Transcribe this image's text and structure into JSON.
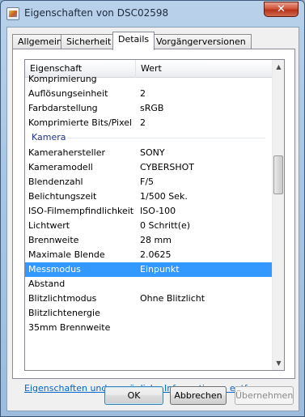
{
  "window": {
    "title": "Eigenschaften von DSC02598",
    "close_glyph": "✕"
  },
  "tabs": [
    {
      "label": "Allgemein",
      "active": false
    },
    {
      "label": "Sicherheit",
      "active": false
    },
    {
      "label": "Details",
      "active": true
    },
    {
      "label": "Vorgängerversionen",
      "active": false
    }
  ],
  "list": {
    "columns": {
      "property": "Eigenschaft",
      "value": "Wert"
    },
    "rows": [
      {
        "k": "Komprimierung",
        "v": ""
      },
      {
        "k": "Auflösungseinheit",
        "v": "2"
      },
      {
        "k": "Farbdarstellung",
        "v": "sRGB"
      },
      {
        "k": "Komprimierte Bits/Pixel",
        "v": "2"
      },
      {
        "k": "Kamera",
        "v": ""
      },
      {
        "k": "Kamerahersteller",
        "v": "SONY"
      },
      {
        "k": "Kameramodell",
        "v": "CYBERSHOT"
      },
      {
        "k": "Blendenzahl",
        "v": "F/5"
      },
      {
        "k": "Belichtungszeit",
        "v": "1/500 Sek."
      },
      {
        "k": "ISO-Filmempfindlichkeit",
        "v": "ISO-100"
      },
      {
        "k": "Lichtwert",
        "v": "0 Schritt(e)"
      },
      {
        "k": "Brennweite",
        "v": "28 mm"
      },
      {
        "k": "Maximale Blende",
        "v": "2.0625"
      },
      {
        "k": "Messmodus",
        "v": "Einpunkt"
      },
      {
        "k": "Abstand",
        "v": ""
      },
      {
        "k": "Blitzlichtmodus",
        "v": "Ohne Blitzlicht"
      },
      {
        "k": "Blitzlichtenergie",
        "v": ""
      },
      {
        "k": "35mm Brennweite",
        "v": ""
      }
    ],
    "scroll_up_glyph": "▲",
    "scroll_down_glyph": "▼"
  },
  "link_text": "Eigenschaften und persönliche Informationen entfernen",
  "buttons": {
    "ok": "OK",
    "cancel": "Abbrechen",
    "apply": "Übernehmen"
  },
  "colors": {
    "selection": "#3399ff",
    "link": "#0066cc",
    "group_header": "#1e3287"
  }
}
